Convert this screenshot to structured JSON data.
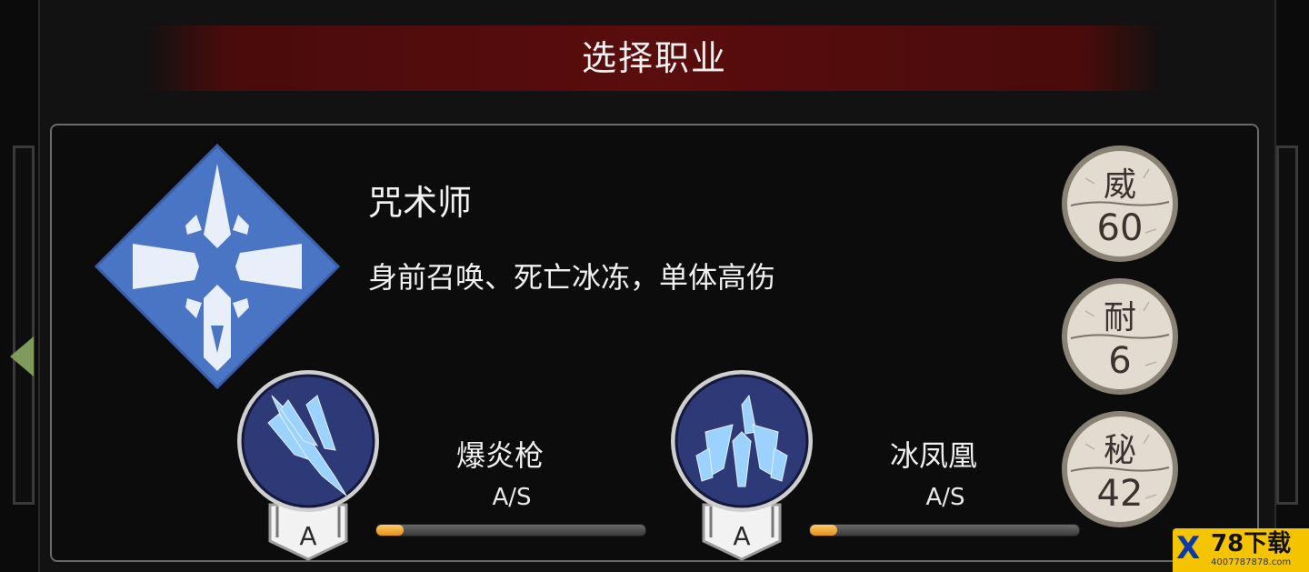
{
  "header": {
    "title": "选择职业"
  },
  "class_info": {
    "name": "咒术师",
    "description": "身前召唤、死亡冰冻，单体高伤",
    "emblem_icon": "star-cross-emblem-icon",
    "emblem_color": "#4a74c4"
  },
  "stats": [
    {
      "label": "威",
      "value": "60"
    },
    {
      "label": "耐",
      "value": "6"
    },
    {
      "label": "秘",
      "value": "42"
    }
  ],
  "skills": [
    {
      "name": "爆炎枪",
      "type": "A/S",
      "rank": "A",
      "progress": 0.1,
      "icon": "ice-spear-icon"
    },
    {
      "name": "冰凤凰",
      "type": "A/S",
      "rank": "A",
      "progress": 0.1,
      "icon": "ice-phoenix-icon"
    }
  ],
  "nav": {
    "prev_icon": "arrow-left-icon"
  },
  "watermark": {
    "title": "78下载",
    "url": "4007787878.com",
    "logo": "X"
  },
  "colors": {
    "header_red": "#5a0d0d",
    "bar_fill": "#f0a020",
    "stat_disc": "#e2dcd0"
  }
}
